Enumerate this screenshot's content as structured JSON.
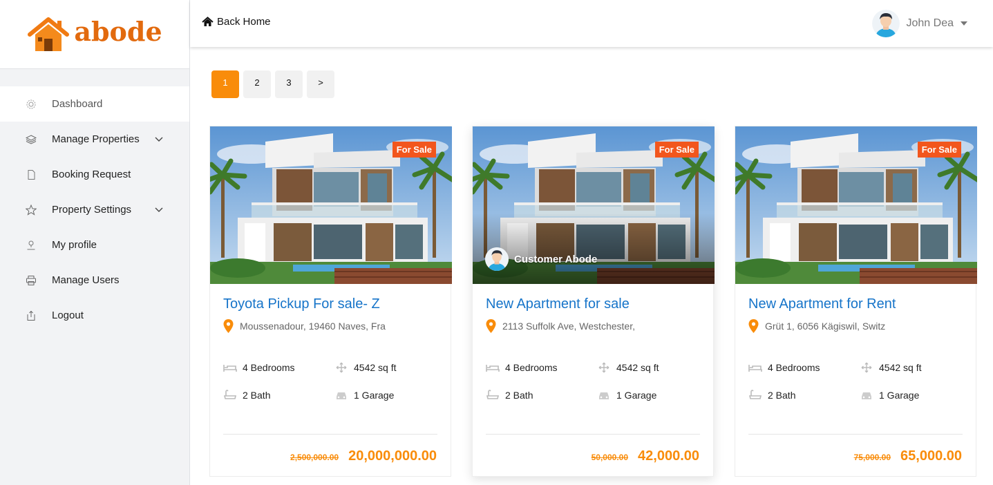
{
  "brand": {
    "logo_text": "abode",
    "accent": "#f98c0a"
  },
  "sidebar": {
    "items": [
      {
        "label": "Dashboard",
        "icon": "gear-icon",
        "active": true,
        "has_submenu": false
      },
      {
        "label": "Manage Properties",
        "icon": "layers-icon",
        "active": false,
        "has_submenu": true
      },
      {
        "label": "Booking Request",
        "icon": "document-icon",
        "active": false,
        "has_submenu": false
      },
      {
        "label": "Property Settings",
        "icon": "star-icon",
        "active": false,
        "has_submenu": true
      },
      {
        "label": "My profile",
        "icon": "user-icon",
        "active": false,
        "has_submenu": false
      },
      {
        "label": "Manage Users",
        "icon": "printer-icon",
        "active": false,
        "has_submenu": false
      },
      {
        "label": "Logout",
        "icon": "logout-icon",
        "active": false,
        "has_submenu": false
      }
    ]
  },
  "header": {
    "back_home_label": "Back Home",
    "user_name": "John Dea"
  },
  "pagination": {
    "pages": [
      "1",
      "2",
      "3",
      ">"
    ],
    "current": "1"
  },
  "listings": [
    {
      "status": "For Sale",
      "title": "Toyota Pickup For sale- Z",
      "address": "Moussenadour, 19460 Naves, Fra",
      "bedrooms": "4 Bedrooms",
      "area": "4542 sq ft",
      "bath": "2 Bath",
      "garage": "1 Garage",
      "old_price": "2,500,000.00",
      "price": "20,000,000.00",
      "agent": null
    },
    {
      "status": "For Sale",
      "title": "New Apartment for sale",
      "address": "2113 Suffolk Ave, Westchester,",
      "bedrooms": "4 Bedrooms",
      "area": "4542 sq ft",
      "bath": "2 Bath",
      "garage": "1 Garage",
      "old_price": "50,000.00",
      "price": "42,000.00",
      "agent": "Customer Abode"
    },
    {
      "status": "For Sale",
      "title": "New Apartment for Rent",
      "address": "Grüt 1, 6056 Kägiswil, Switz",
      "bedrooms": "4 Bedrooms",
      "area": "4542 sq ft",
      "bath": "2 Bath",
      "garage": "1 Garage",
      "old_price": "75,000.00",
      "price": "65,000.00",
      "agent": null
    }
  ]
}
